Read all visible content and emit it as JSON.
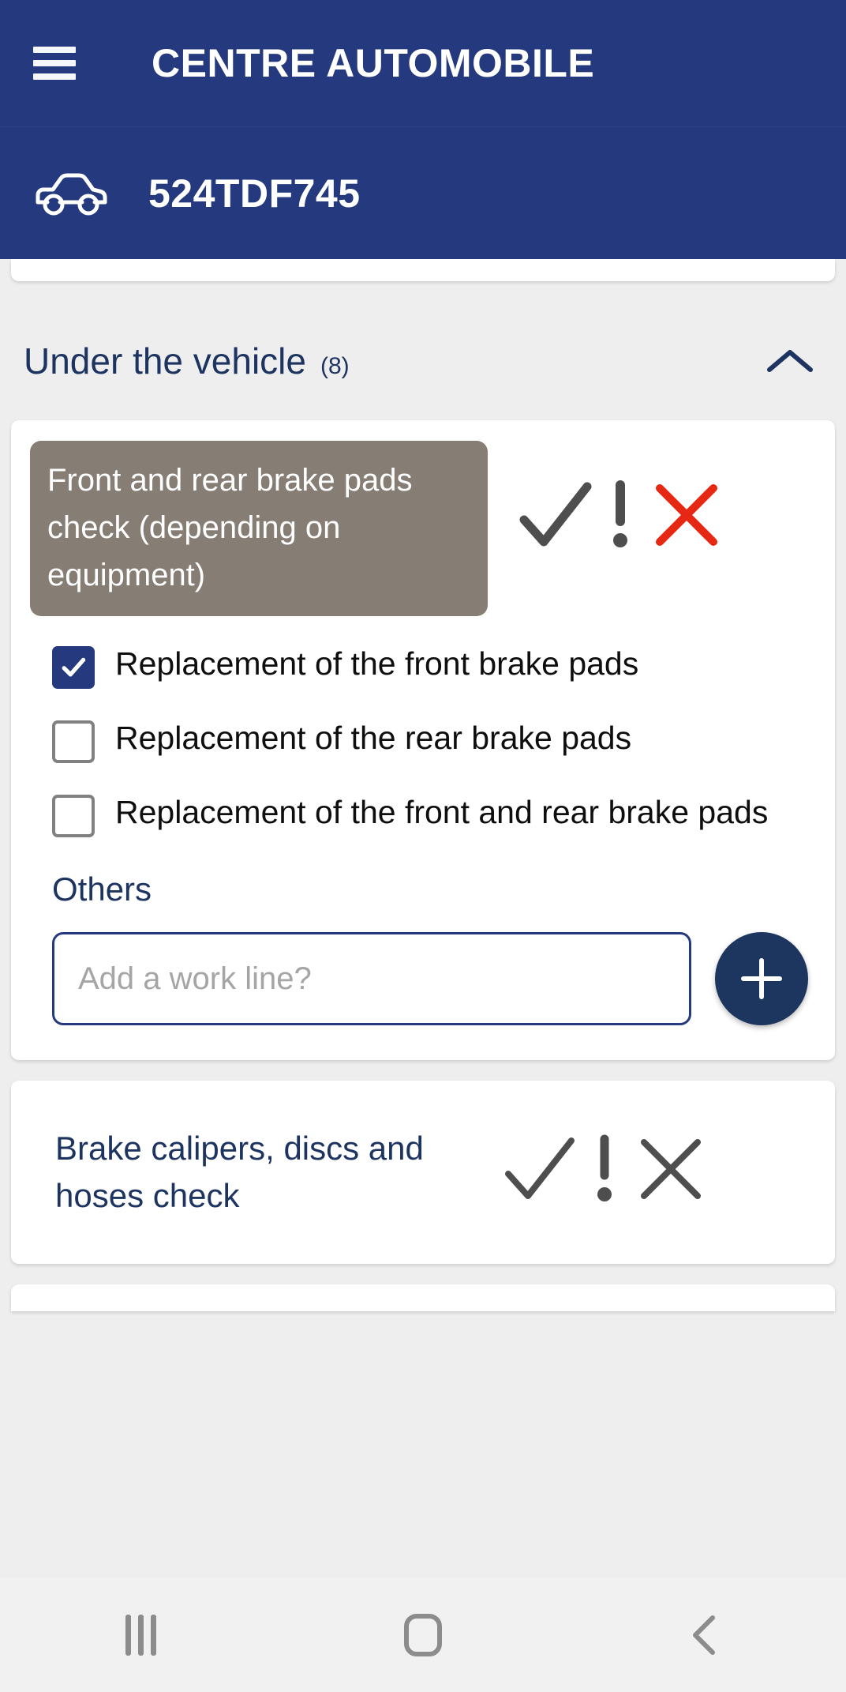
{
  "appbar": {
    "menu_icon": "hamburger-menu-icon",
    "title": "CENTRE AUTOMOBILE"
  },
  "vehicle": {
    "icon": "car-icon",
    "plate": "524TDF745"
  },
  "section": {
    "title": "Under the vehicle",
    "count": "(8)",
    "collapse_icon": "chevron-up-icon",
    "expanded": true
  },
  "checks": [
    {
      "label": "Front and rear brake pads check (depending on equipment)",
      "label_style": "gray-highlight",
      "status": {
        "ok_icon": "checkmark-icon",
        "warning_icon": "exclamation-icon",
        "fail_icon": "cross-icon",
        "selected": "fail"
      },
      "options": [
        {
          "label": "Replacement of the front brake pads",
          "checked": true
        },
        {
          "label": "Replacement of the rear brake pads",
          "checked": false
        },
        {
          "label": "Replacement of the front and rear brake pads",
          "checked": false
        }
      ],
      "others_label": "Others",
      "work_input": {
        "value": "",
        "placeholder": "Add a work line?"
      },
      "add_button": "plus-icon"
    },
    {
      "label": "Brake calipers, discs and hoses check",
      "label_style": "plain",
      "status": {
        "ok_icon": "checkmark-icon",
        "warning_icon": "exclamation-icon",
        "fail_icon": "cross-icon",
        "selected": "none"
      }
    }
  ],
  "navbar": {
    "recents": "recents-icon",
    "home": "home-icon",
    "back": "back-icon"
  },
  "colors": {
    "brand_blue": "#25397e",
    "deep_blue": "#1d3461",
    "fab_blue": "#1d3660",
    "gray_chip": "#867d74",
    "fail_red": "#e52713",
    "icon_gray": "#4e4e4e",
    "page_bg": "#efeeee"
  }
}
